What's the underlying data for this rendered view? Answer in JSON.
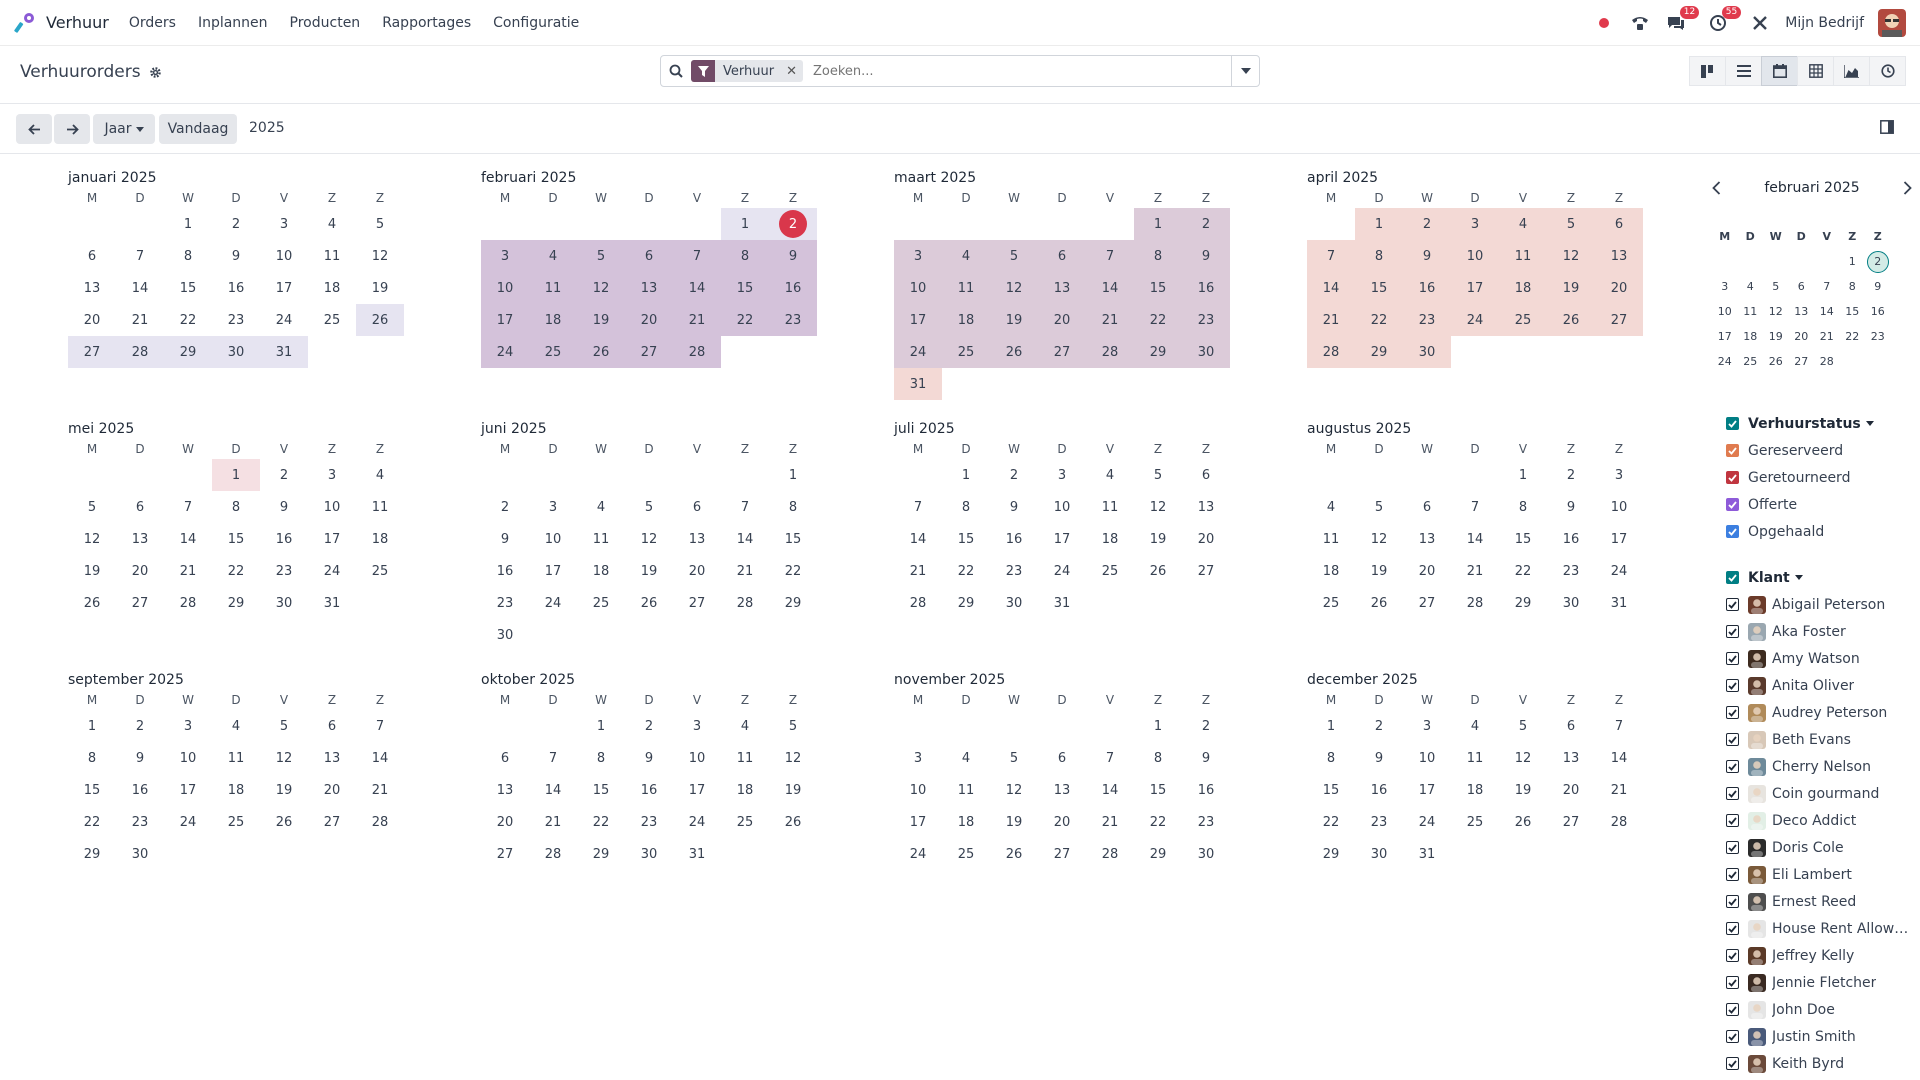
{
  "navbar": {
    "app_name": "Verhuur",
    "menu": [
      "Orders",
      "Inplannen",
      "Producten",
      "Rapportages",
      "Configuratie"
    ],
    "messages_badge": "12",
    "activity_badge": "55",
    "company": "Mijn Bedrijf"
  },
  "control": {
    "title": "Verhuurorders",
    "facet": "Verhuur",
    "search_placeholder": "Zoeken..."
  },
  "toolbar": {
    "scale": "Jaar",
    "today": "Vandaag",
    "period": "2025"
  },
  "weekdays": [
    "M",
    "D",
    "W",
    "D",
    "V",
    "Z",
    "Z"
  ],
  "months": [
    {
      "title": "januari 2025",
      "rows": [
        [
          "",
          "",
          "1",
          "2",
          "3",
          "4",
          "5"
        ],
        [
          "6",
          "7",
          "8",
          "9",
          "10",
          "11",
          "12"
        ],
        [
          "13",
          "14",
          "15",
          "16",
          "17",
          "18",
          "19"
        ],
        [
          "20",
          "21",
          "22",
          "23",
          "24",
          "25",
          "26"
        ],
        [
          "27",
          "28",
          "29",
          "30",
          "31",
          "",
          ""
        ]
      ]
    },
    {
      "title": "februari 2025",
      "rows": [
        [
          "",
          "",
          "",
          "",
          "",
          "1",
          "2"
        ],
        [
          "3",
          "4",
          "5",
          "6",
          "7",
          "8",
          "9"
        ],
        [
          "10",
          "11",
          "12",
          "13",
          "14",
          "15",
          "16"
        ],
        [
          "17",
          "18",
          "19",
          "20",
          "21",
          "22",
          "23"
        ],
        [
          "24",
          "25",
          "26",
          "27",
          "28",
          "",
          ""
        ]
      ]
    },
    {
      "title": "maart 2025",
      "rows": [
        [
          "",
          "",
          "",
          "",
          "",
          "1",
          "2"
        ],
        [
          "3",
          "4",
          "5",
          "6",
          "7",
          "8",
          "9"
        ],
        [
          "10",
          "11",
          "12",
          "13",
          "14",
          "15",
          "16"
        ],
        [
          "17",
          "18",
          "19",
          "20",
          "21",
          "22",
          "23"
        ],
        [
          "24",
          "25",
          "26",
          "27",
          "28",
          "29",
          "30"
        ],
        [
          "31",
          "",
          "",
          "",
          "",
          "",
          ""
        ]
      ]
    },
    {
      "title": "april 2025",
      "rows": [
        [
          "",
          "1",
          "2",
          "3",
          "4",
          "5",
          "6"
        ],
        [
          "7",
          "8",
          "9",
          "10",
          "11",
          "12",
          "13"
        ],
        [
          "14",
          "15",
          "16",
          "17",
          "18",
          "19",
          "20"
        ],
        [
          "21",
          "22",
          "23",
          "24",
          "25",
          "26",
          "27"
        ],
        [
          "28",
          "29",
          "30",
          "",
          "",
          "",
          ""
        ]
      ]
    },
    {
      "title": "mei 2025",
      "rows": [
        [
          "",
          "",
          "",
          "1",
          "2",
          "3",
          "4"
        ],
        [
          "5",
          "6",
          "7",
          "8",
          "9",
          "10",
          "11"
        ],
        [
          "12",
          "13",
          "14",
          "15",
          "16",
          "17",
          "18"
        ],
        [
          "19",
          "20",
          "21",
          "22",
          "23",
          "24",
          "25"
        ],
        [
          "26",
          "27",
          "28",
          "29",
          "30",
          "31",
          ""
        ]
      ]
    },
    {
      "title": "juni 2025",
      "rows": [
        [
          "",
          "",
          "",
          "",
          "",
          "",
          "1"
        ],
        [
          "2",
          "3",
          "4",
          "5",
          "6",
          "7",
          "8"
        ],
        [
          "9",
          "10",
          "11",
          "12",
          "13",
          "14",
          "15"
        ],
        [
          "16",
          "17",
          "18",
          "19",
          "20",
          "21",
          "22"
        ],
        [
          "23",
          "24",
          "25",
          "26",
          "27",
          "28",
          "29"
        ],
        [
          "30",
          "",
          "",
          "",
          "",
          "",
          ""
        ]
      ]
    },
    {
      "title": "juli 2025",
      "rows": [
        [
          "",
          "1",
          "2",
          "3",
          "4",
          "5",
          "6"
        ],
        [
          "7",
          "8",
          "9",
          "10",
          "11",
          "12",
          "13"
        ],
        [
          "14",
          "15",
          "16",
          "17",
          "18",
          "19",
          "20"
        ],
        [
          "21",
          "22",
          "23",
          "24",
          "25",
          "26",
          "27"
        ],
        [
          "28",
          "29",
          "30",
          "31",
          "",
          "",
          ""
        ]
      ]
    },
    {
      "title": "augustus 2025",
      "rows": [
        [
          "",
          "",
          "",
          "",
          "1",
          "2",
          "3"
        ],
        [
          "4",
          "5",
          "6",
          "7",
          "8",
          "9",
          "10"
        ],
        [
          "11",
          "12",
          "13",
          "14",
          "15",
          "16",
          "17"
        ],
        [
          "18",
          "19",
          "20",
          "21",
          "22",
          "23",
          "24"
        ],
        [
          "25",
          "26",
          "27",
          "28",
          "29",
          "30",
          "31"
        ]
      ]
    },
    {
      "title": "september 2025",
      "rows": [
        [
          "1",
          "2",
          "3",
          "4",
          "5",
          "6",
          "7"
        ],
        [
          "8",
          "9",
          "10",
          "11",
          "12",
          "13",
          "14"
        ],
        [
          "15",
          "16",
          "17",
          "18",
          "19",
          "20",
          "21"
        ],
        [
          "22",
          "23",
          "24",
          "25",
          "26",
          "27",
          "28"
        ],
        [
          "29",
          "30",
          "",
          "",
          "",
          "",
          ""
        ]
      ]
    },
    {
      "title": "oktober 2025",
      "rows": [
        [
          "",
          "",
          "1",
          "2",
          "3",
          "4",
          "5"
        ],
        [
          "6",
          "7",
          "8",
          "9",
          "10",
          "11",
          "12"
        ],
        [
          "13",
          "14",
          "15",
          "16",
          "17",
          "18",
          "19"
        ],
        [
          "20",
          "21",
          "22",
          "23",
          "24",
          "25",
          "26"
        ],
        [
          "27",
          "28",
          "29",
          "30",
          "31",
          "",
          ""
        ]
      ]
    },
    {
      "title": "november 2025",
      "rows": [
        [
          "",
          "",
          "",
          "",
          "",
          "1",
          "2"
        ],
        [
          "3",
          "4",
          "5",
          "6",
          "7",
          "8",
          "9"
        ],
        [
          "10",
          "11",
          "12",
          "13",
          "14",
          "15",
          "16"
        ],
        [
          "17",
          "18",
          "19",
          "20",
          "21",
          "22",
          "23"
        ],
        [
          "24",
          "25",
          "26",
          "27",
          "28",
          "29",
          "30"
        ]
      ]
    },
    {
      "title": "december 2025",
      "rows": [
        [
          "1",
          "2",
          "3",
          "4",
          "5",
          "6",
          "7"
        ],
        [
          "8",
          "9",
          "10",
          "11",
          "12",
          "13",
          "14"
        ],
        [
          "15",
          "16",
          "17",
          "18",
          "19",
          "20",
          "21"
        ],
        [
          "22",
          "23",
          "24",
          "25",
          "26",
          "27",
          "28"
        ],
        [
          "29",
          "30",
          "31",
          "",
          "",
          "",
          ""
        ]
      ]
    }
  ],
  "highlights": {
    "colors": {
      "lav": "#e6e4f1",
      "pur": "#d4c2da",
      "mauve": "#dccbd9",
      "pink": "#f3d9d5",
      "rose": "#f5e0e3",
      "today": "#d9374b"
    },
    "today": {
      "month": 1,
      "day": "2"
    },
    "ranges": [
      {
        "month": 0,
        "from": 26,
        "to": 31,
        "tone": "lav"
      },
      {
        "month": 1,
        "from": 1,
        "to": 2,
        "tone": "lav"
      },
      {
        "month": 1,
        "from": 3,
        "to": 28,
        "tone": "pur"
      },
      {
        "month": 2,
        "from": 1,
        "to": 30,
        "tone": "mauve"
      },
      {
        "month": 2,
        "from": 31,
        "to": 31,
        "tone": "pink"
      },
      {
        "month": 3,
        "from": 1,
        "to": 30,
        "tone": "pink"
      },
      {
        "month": 4,
        "from": 1,
        "to": 1,
        "tone": "rose"
      }
    ]
  },
  "mini_calendar": {
    "title": "februari 2025",
    "weekdays": [
      "M",
      "D",
      "W",
      "D",
      "V",
      "Z",
      "Z"
    ],
    "rows": [
      [
        "",
        "",
        "",
        "",
        "",
        "1",
        "2"
      ],
      [
        "3",
        "4",
        "5",
        "6",
        "7",
        "8",
        "9"
      ],
      [
        "10",
        "11",
        "12",
        "13",
        "14",
        "15",
        "16"
      ],
      [
        "17",
        "18",
        "19",
        "20",
        "21",
        "22",
        "23"
      ],
      [
        "24",
        "25",
        "26",
        "27",
        "28",
        "",
        ""
      ]
    ],
    "selected": "2"
  },
  "filters": {
    "status_title": "Verhuurstatus",
    "statuses": [
      {
        "label": "Gereserveerd",
        "color": "#e07b4f"
      },
      {
        "label": "Geretourneerd",
        "color": "#c0353f"
      },
      {
        "label": "Offerte",
        "color": "#8e5bd9"
      },
      {
        "label": "Opgehaald",
        "color": "#3c7fe0"
      }
    ],
    "customer_title": "Klant",
    "customers": [
      "Abigail Peterson",
      "Aka Foster",
      "Amy Watson",
      "Anita Oliver",
      "Audrey Peterson",
      "Beth Evans",
      "Cherry Nelson",
      "Coin gourmand",
      "Deco Addict",
      "Doris Cole",
      "Eli Lambert",
      "Ernest Reed",
      "House Rent Allowa…",
      "Jeffrey Kelly",
      "Jennie Fletcher",
      "John Doe",
      "Justin Smith",
      "Keith Byrd"
    ]
  }
}
